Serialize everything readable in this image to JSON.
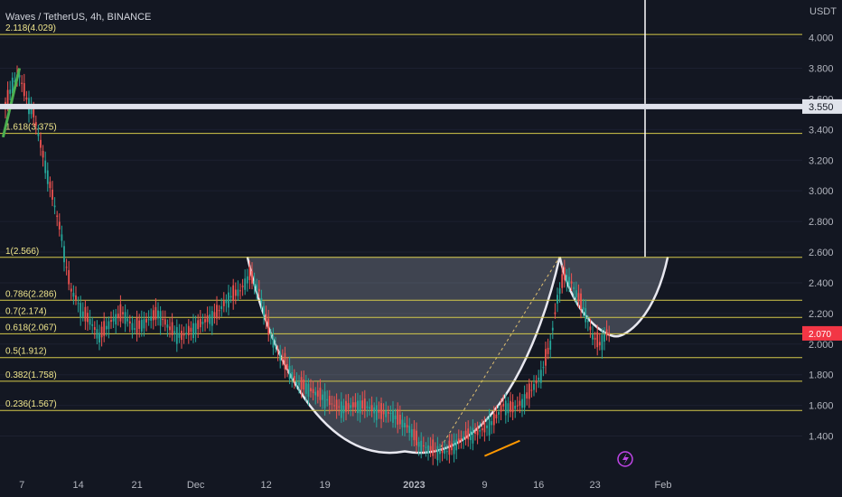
{
  "chart_data": {
    "type": "candlestick",
    "title": "Waves / TetherUS, 4h, BINANCE",
    "currency": "USDT",
    "y_ticks": [
      "4.000",
      "3.800",
      "3.600",
      "3.400",
      "3.200",
      "3.000",
      "2.800",
      "2.600",
      "2.400",
      "2.200",
      "2.000",
      "1.800",
      "1.600",
      "1.400"
    ],
    "ylim": [
      1.25,
      4.08
    ],
    "x_ticks": [
      "7",
      "14",
      "21",
      "Dec",
      "12",
      "19",
      "2023",
      "9",
      "16",
      "23",
      "Feb"
    ],
    "fib_levels": [
      {
        "label": "2.118(4.029)",
        "value": 4.02
      },
      {
        "label": "1.618(3.375)",
        "value": 3.375
      },
      {
        "label": "1(2.566)",
        "value": 2.566
      },
      {
        "label": "0.786(2.286)",
        "value": 2.286
      },
      {
        "label": "0.7(2.174)",
        "value": 2.174
      },
      {
        "label": "0.618(2.067)",
        "value": 2.067
      },
      {
        "label": "0.5(1.912)",
        "value": 1.912
      },
      {
        "label": "0.382(1.758)",
        "value": 1.758
      },
      {
        "label": "0.236(1.567)",
        "value": 1.567
      }
    ],
    "resistance_line": {
      "value": 3.55,
      "label": "3.550"
    },
    "last_price": {
      "value": 2.07,
      "label": "2.070"
    },
    "price_series": [
      [
        0,
        3.55
      ],
      [
        3,
        3.7
      ],
      [
        6,
        3.75
      ],
      [
        9,
        3.6
      ],
      [
        12,
        3.5
      ],
      [
        15,
        3.3
      ],
      [
        18,
        3.1
      ],
      [
        21,
        2.9
      ],
      [
        24,
        2.7
      ],
      [
        26,
        2.5
      ],
      [
        28,
        2.35
      ],
      [
        30,
        2.3
      ],
      [
        33,
        2.2
      ],
      [
        36,
        2.15
      ],
      [
        40,
        2.05
      ],
      [
        45,
        2.15
      ],
      [
        50,
        2.2
      ],
      [
        55,
        2.1
      ],
      [
        60,
        2.15
      ],
      [
        65,
        2.2
      ],
      [
        70,
        2.1
      ],
      [
        75,
        2.05
      ],
      [
        80,
        2.1
      ],
      [
        85,
        2.15
      ],
      [
        90,
        2.2
      ],
      [
        95,
        2.3
      ],
      [
        100,
        2.35
      ],
      [
        104,
        2.45
      ],
      [
        108,
        2.35
      ],
      [
        112,
        2.1
      ],
      [
        116,
        1.95
      ],
      [
        120,
        1.85
      ],
      [
        124,
        1.75
      ],
      [
        128,
        1.72
      ],
      [
        132,
        1.68
      ],
      [
        136,
        1.65
      ],
      [
        140,
        1.6
      ],
      [
        144,
        1.58
      ],
      [
        148,
        1.6
      ],
      [
        152,
        1.6
      ],
      [
        156,
        1.58
      ],
      [
        160,
        1.55
      ],
      [
        164,
        1.55
      ],
      [
        168,
        1.5
      ],
      [
        172,
        1.45
      ],
      [
        176,
        1.35
      ],
      [
        180,
        1.32
      ],
      [
        184,
        1.3
      ],
      [
        188,
        1.3
      ],
      [
        192,
        1.35
      ],
      [
        196,
        1.4
      ],
      [
        200,
        1.42
      ],
      [
        204,
        1.45
      ],
      [
        208,
        1.5
      ],
      [
        212,
        1.6
      ],
      [
        216,
        1.58
      ],
      [
        220,
        1.62
      ],
      [
        224,
        1.7
      ],
      [
        228,
        1.8
      ],
      [
        232,
        2.0
      ],
      [
        235,
        2.3
      ],
      [
        238,
        2.45
      ],
      [
        241,
        2.4
      ],
      [
        244,
        2.3
      ],
      [
        247,
        2.2
      ],
      [
        250,
        2.05
      ],
      [
        253,
        2.0
      ],
      [
        256,
        2.07
      ],
      [
        258,
        2.07
      ]
    ],
    "cup_handle": {
      "cup_left": [
        103,
        2.57
      ],
      "cup_bottom": [
        170,
        1.3
      ],
      "cup_right": [
        236,
        2.57
      ],
      "handle_bottom": [
        260,
        2.05
      ],
      "handle_right": [
        282,
        2.57
      ]
    }
  }
}
